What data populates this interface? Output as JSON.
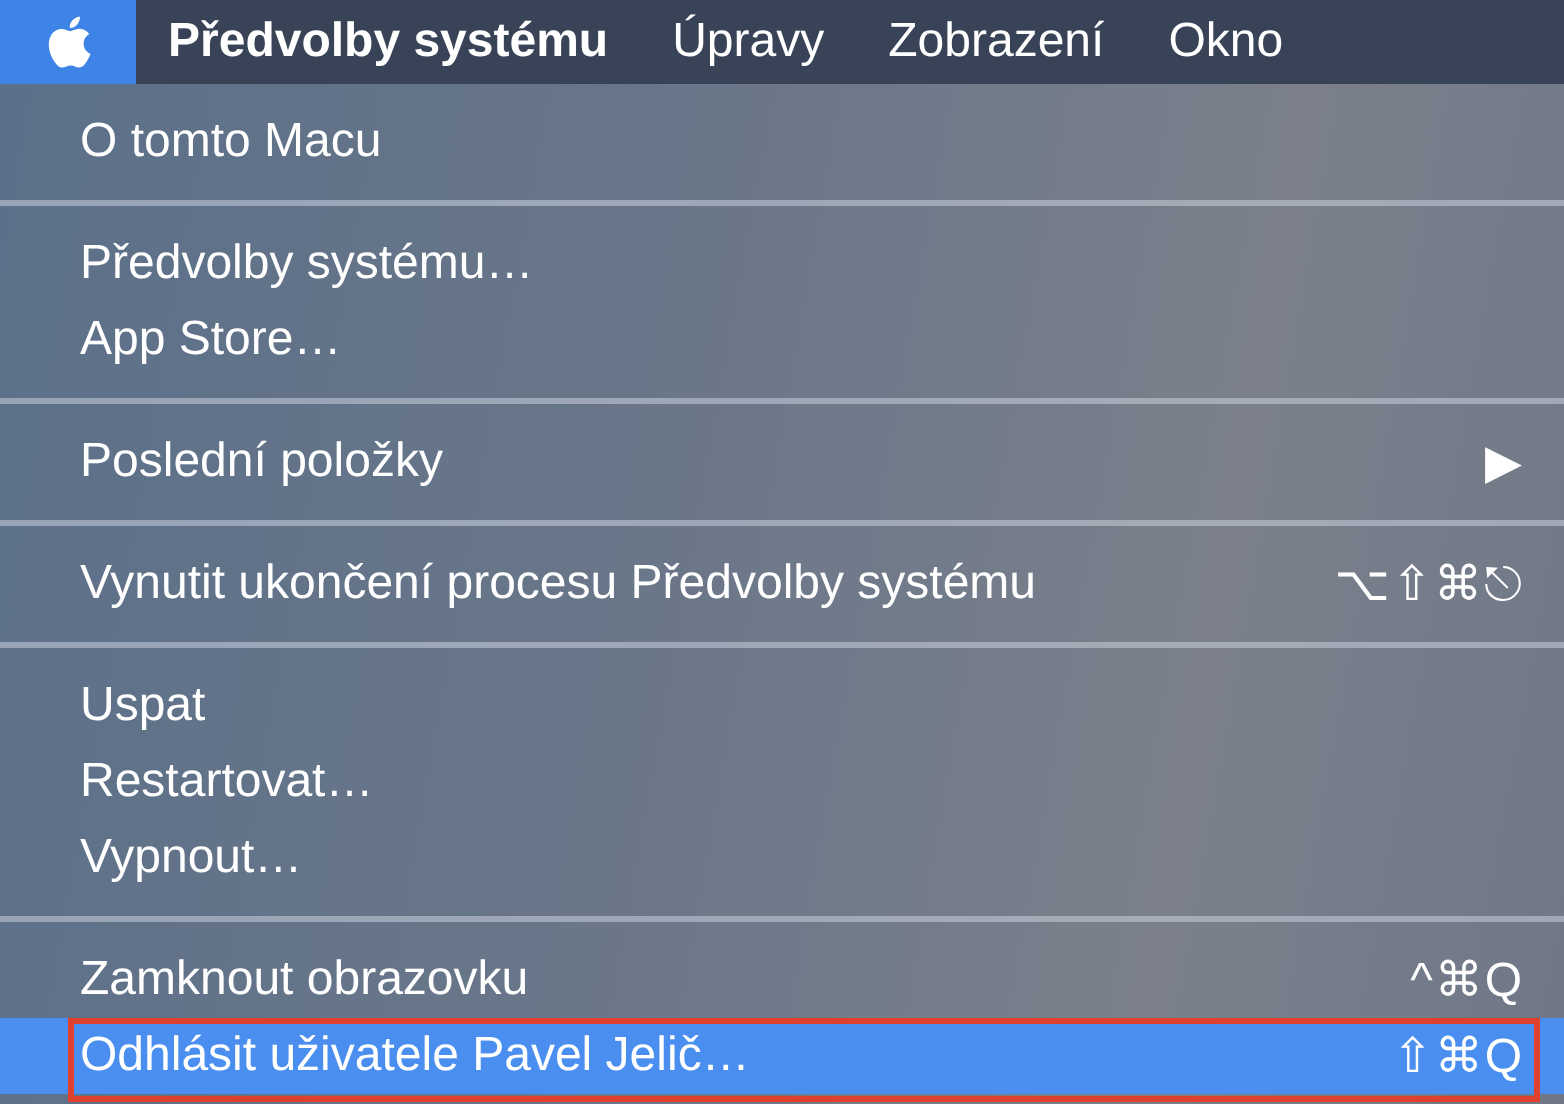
{
  "menu_bar": {
    "items": [
      {
        "label": "Předvolby systému",
        "selected": false,
        "bold": true
      },
      {
        "label": "Úpravy",
        "selected": false,
        "bold": false
      },
      {
        "label": "Zobrazení",
        "selected": false,
        "bold": false
      },
      {
        "label": "Okno",
        "selected": false,
        "bold": false
      }
    ],
    "apple_selected": true
  },
  "menu": {
    "groups": [
      {
        "items": [
          {
            "label": "O tomto Macu",
            "selected": false
          }
        ]
      },
      {
        "items": [
          {
            "label": "Předvolby systému…",
            "selected": false
          },
          {
            "label": "App Store…",
            "selected": false
          }
        ]
      },
      {
        "items": [
          {
            "label": "Poslední položky",
            "selected": false,
            "submenu": "▶"
          }
        ]
      },
      {
        "items": [
          {
            "label": "Vynutit ukončení procesu Předvolby systému",
            "selected": false,
            "shortcut": "⌥⇧⌘⎋"
          }
        ]
      },
      {
        "items": [
          {
            "label": "Uspat",
            "selected": false
          },
          {
            "label": "Restartovat…",
            "selected": false
          },
          {
            "label": "Vypnout…",
            "selected": false
          }
        ]
      },
      {
        "items": [
          {
            "label": "Zamknout obrazovku",
            "selected": false,
            "shortcut": "^⌘Q"
          },
          {
            "label": "Odhlásit uživatele Pavel Jelič…",
            "selected": true,
            "shortcut": "⇧⌘Q",
            "annotated": true
          }
        ]
      }
    ]
  }
}
